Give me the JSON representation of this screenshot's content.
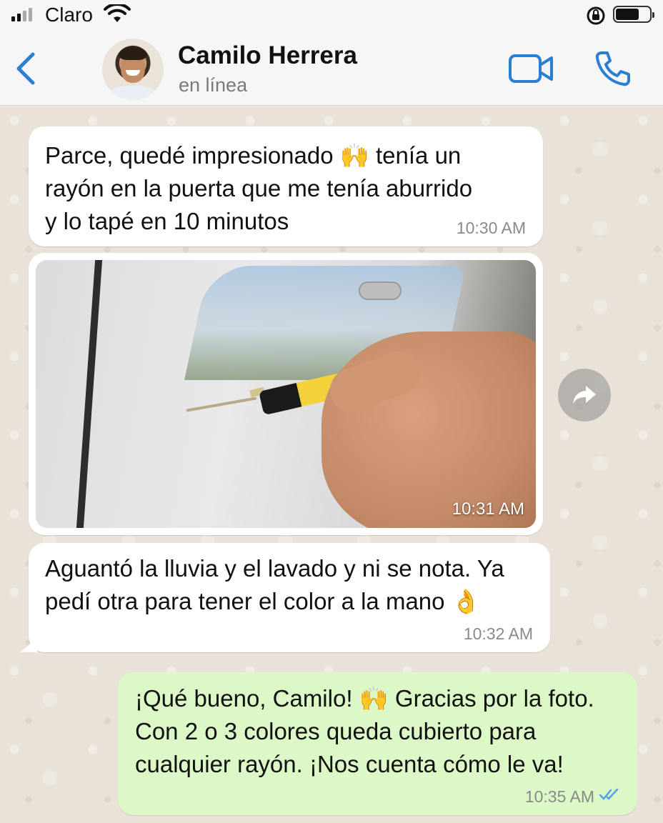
{
  "status_bar": {
    "carrier": "Claro"
  },
  "header": {
    "contact_name": "Camilo Herrera",
    "contact_status": "en línea"
  },
  "messages": [
    {
      "direction": "in",
      "text": "Parce, quedé impresionado 🙌 tenía un\nrayón en la puerta que me tenía aburrido\ny lo tapé en 10 minutos",
      "time": "10:30 AM"
    },
    {
      "direction": "in",
      "type": "image",
      "time": "10:31 AM"
    },
    {
      "direction": "in",
      "text": "Aguantó la lluvia y el lavado y ni se nota. Ya\npedí otra para tener el color a la mano 👌",
      "time": "10:32 AM"
    },
    {
      "direction": "out",
      "text": "¡Qué bueno, Camilo! 🙌 Gracias por la foto.\nCon 2 o 3 colores queda cubierto para\ncualquier rayón. ¡Nos cuenta cómo le va!",
      "time": "10:35 AM",
      "read_status": "read"
    }
  ],
  "colors": {
    "accent_blue": "#2a7fd4",
    "outgoing_bubble": "#dcf8c6",
    "read_ticks": "#4fa3e6"
  },
  "icons": {
    "back": "chevron-left-icon",
    "video": "video-camera-icon",
    "call": "phone-icon",
    "forward": "forward-arrow-icon",
    "ticks": "double-check-icon"
  }
}
